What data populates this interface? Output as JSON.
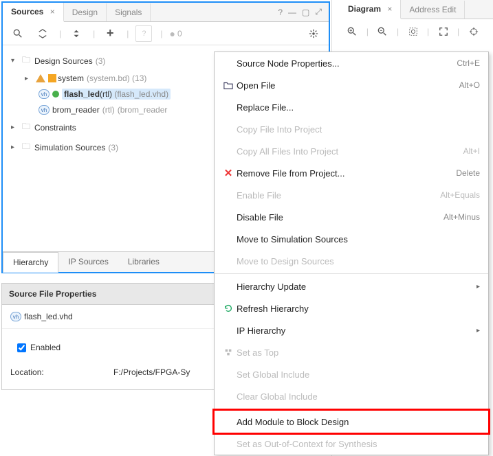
{
  "left": {
    "tabs": [
      "Sources",
      "Design",
      "Signals"
    ],
    "active_tab": 0,
    "help_icon": "?",
    "toolbar_count": "0",
    "tree": {
      "design_sources": {
        "label": "Design Sources",
        "count": "(3)"
      },
      "system": {
        "label": "system",
        "sub": "(system.bd) (13)"
      },
      "flash_led": {
        "name": "flash_led",
        "rtl": "(rtl)",
        "file": "(flash_led.vhd)"
      },
      "brom_reader": {
        "name": "brom_reader",
        "rtl": "(rtl)",
        "file": "(brom_reader"
      },
      "constraints": {
        "label": "Constraints"
      },
      "sim_sources": {
        "label": "Simulation Sources",
        "count": "(3)"
      }
    },
    "bottom_tabs": [
      "Hierarchy",
      "IP Sources",
      "Libraries"
    ],
    "bottom_active": 0,
    "props": {
      "title": "Source File Properties",
      "file": "flash_led.vhd",
      "enabled_label": "Enabled",
      "location_label": "Location:",
      "location_value": "F:/Projects/FPGA-Sy"
    }
  },
  "right": {
    "tabs": [
      "Diagram",
      "Address Edit"
    ],
    "active_tab": 0
  },
  "menu": {
    "items": [
      {
        "label": "Source Node Properties...",
        "shortcut": "Ctrl+E",
        "icon": ""
      },
      {
        "label": "Open File",
        "shortcut": "Alt+O",
        "icon": "folder-open"
      },
      {
        "label": "Replace File...",
        "shortcut": "",
        "icon": ""
      },
      {
        "label": "Copy File Into Project",
        "shortcut": "",
        "disabled": true
      },
      {
        "label": "Copy All Files Into Project",
        "shortcut": "Alt+I",
        "disabled": true
      },
      {
        "label": "Remove File from Project...",
        "shortcut": "Delete",
        "icon": "remove-x"
      },
      {
        "label": "Enable File",
        "shortcut": "Alt+Equals",
        "disabled": true
      },
      {
        "label": "Disable File",
        "shortcut": "Alt+Minus"
      },
      {
        "label": "Move to Simulation Sources",
        "shortcut": ""
      },
      {
        "label": "Move to Design Sources",
        "shortcut": "",
        "disabled": true
      },
      {
        "sep": true
      },
      {
        "label": "Hierarchy Update",
        "shortcut": "",
        "submenu": true
      },
      {
        "label": "Refresh Hierarchy",
        "shortcut": "",
        "icon": "refresh"
      },
      {
        "label": "IP Hierarchy",
        "shortcut": "",
        "submenu": true
      },
      {
        "label": "Set as Top",
        "shortcut": "",
        "disabled": true,
        "icon": "set-top"
      },
      {
        "label": "Set Global Include",
        "shortcut": "",
        "disabled": true
      },
      {
        "label": "Clear Global Include",
        "shortcut": "",
        "disabled": true
      },
      {
        "sep": true
      },
      {
        "label": "Add Module to Block Design",
        "shortcut": "",
        "highlight": true
      },
      {
        "label": "Set as Out-of-Context for Synthesis",
        "shortcut": "",
        "disabled": true
      }
    ]
  }
}
